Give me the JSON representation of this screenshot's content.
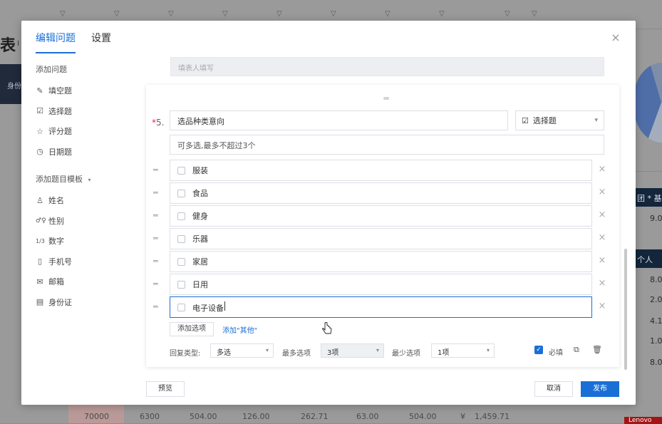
{
  "background": {
    "title": "表",
    "title_sub": "I",
    "side_bar_text": "身份",
    "right_header_top": "团 * 基",
    "right_header_mid": "个人",
    "right_values": [
      "9.0",
      "8.0",
      "2.0",
      "4.1",
      "1.0",
      "8.0"
    ],
    "bottom_cells": [
      "70000",
      "6300",
      "504.00",
      "126.00",
      "262.71",
      "63.00",
      "504.00",
      "¥",
      "1,459.71"
    ],
    "red_tag": "Lenovo"
  },
  "modal": {
    "tabs": [
      {
        "label": "编辑问题",
        "active": true
      },
      {
        "label": "设置",
        "active": false
      }
    ],
    "close_icon": "×"
  },
  "left_panel": {
    "add_question_title": "添加问题",
    "question_types": [
      {
        "icon": "pencil-icon",
        "glyph": "✎",
        "label": "填空题"
      },
      {
        "icon": "checkbox-icon",
        "glyph": "☑",
        "label": "选择题"
      },
      {
        "icon": "star-icon",
        "glyph": "☆",
        "label": "评分题"
      },
      {
        "icon": "clock-icon",
        "glyph": "◷",
        "label": "日期题"
      }
    ],
    "template_title": "添加题目模板",
    "templates": [
      {
        "icon": "person-icon",
        "glyph": "♙",
        "label": "姓名"
      },
      {
        "icon": "gender-icon",
        "glyph": "♂♀",
        "label": "性别"
      },
      {
        "icon": "number-icon",
        "glyph": "1/3",
        "label": "数字"
      },
      {
        "icon": "phone-icon",
        "glyph": "▯",
        "label": "手机号"
      },
      {
        "icon": "mail-icon",
        "glyph": "✉",
        "label": "邮箱"
      },
      {
        "icon": "id-card-icon",
        "glyph": "▤",
        "label": "身份证"
      }
    ]
  },
  "prev_field_placeholder": "填表人填写",
  "question": {
    "required_mark": "*",
    "number": "5.",
    "title": "选品种类意向",
    "type": "选择题",
    "description": "可多选,最多不超过3个",
    "options": [
      {
        "label": "服装",
        "focused": false
      },
      {
        "label": "食品",
        "focused": false
      },
      {
        "label": "健身",
        "focused": false
      },
      {
        "label": "乐器",
        "focused": false
      },
      {
        "label": "家居",
        "focused": false
      },
      {
        "label": "日用",
        "focused": false
      },
      {
        "label": "电子设备",
        "focused": true
      }
    ],
    "add_option_label": "添加选项",
    "add_other_label": "添加\"其他\"",
    "answer_type_label": "回复类型:",
    "answer_type_value": "多选",
    "max_label": "最多选项",
    "max_value": "3项",
    "min_label": "最少选项",
    "min_value": "1项",
    "required_label": "必填",
    "required_checked": true
  },
  "footer": {
    "preview_label": "预览",
    "cancel_label": "取消",
    "publish_label": "发布"
  },
  "colors": {
    "accent": "#1a6fd6",
    "overlay": "#8c8c8c"
  }
}
